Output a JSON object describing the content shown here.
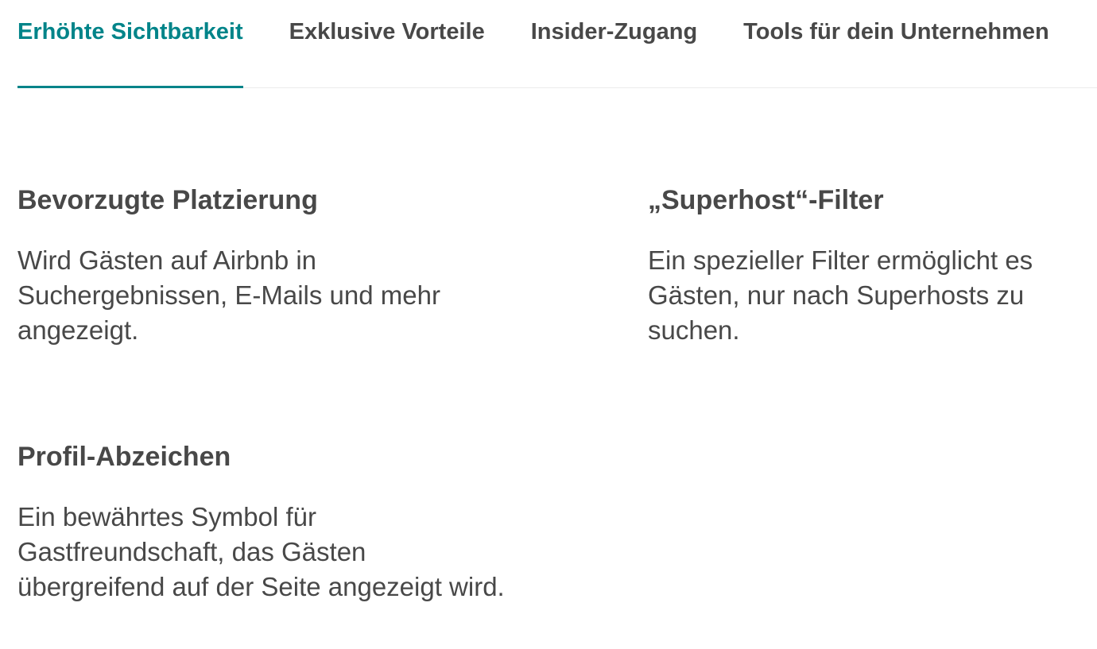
{
  "tabs": [
    {
      "label": "Erhöhte Sichtbarkeit",
      "active": true
    },
    {
      "label": "Exklusive Vorteile",
      "active": false
    },
    {
      "label": "Insider-Zugang",
      "active": false
    },
    {
      "label": "Tools für dein Unternehmen",
      "active": false
    }
  ],
  "colors": {
    "accent": "#008489",
    "text": "#484848",
    "divider": "#ebebeb"
  },
  "features": [
    {
      "title": "Bevorzugte Platzierung",
      "description": "Wird Gästen auf Airbnb in Suchergebnissen, E-Mails und mehr angezeigt."
    },
    {
      "title": "„Superhost“-Filter",
      "description": "Ein spezieller Filter ermöglicht es Gästen, nur nach Superhosts zu suchen."
    },
    {
      "title": "Profil-Abzeichen",
      "description": "Ein bewährtes Symbol für Gastfreundschaft, das Gästen übergreifend auf der Seite angezeigt wird."
    }
  ]
}
